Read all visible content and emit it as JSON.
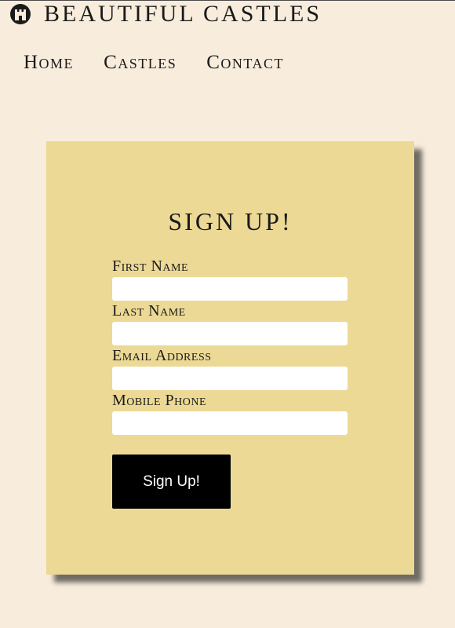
{
  "header": {
    "logo_icon": "castle-icon",
    "title": "Beautiful Castles"
  },
  "nav": {
    "items": [
      {
        "label": "Home"
      },
      {
        "label": "Castles"
      },
      {
        "label": "Contact"
      }
    ]
  },
  "form": {
    "title": "Sign Up!",
    "fields": [
      {
        "label": "First Name",
        "value": "",
        "placeholder": ""
      },
      {
        "label": "Last Name",
        "value": "",
        "placeholder": ""
      },
      {
        "label": "Email Address",
        "value": "",
        "placeholder": ""
      },
      {
        "label": "Mobile Phone",
        "value": "",
        "placeholder": ""
      }
    ],
    "submit_label": "Sign Up!"
  },
  "colors": {
    "page_background": "#f8ecdc",
    "card_background": "#ecd995",
    "button_background": "#000000",
    "button_text": "#ffffff",
    "text": "#1a1a1a"
  }
}
